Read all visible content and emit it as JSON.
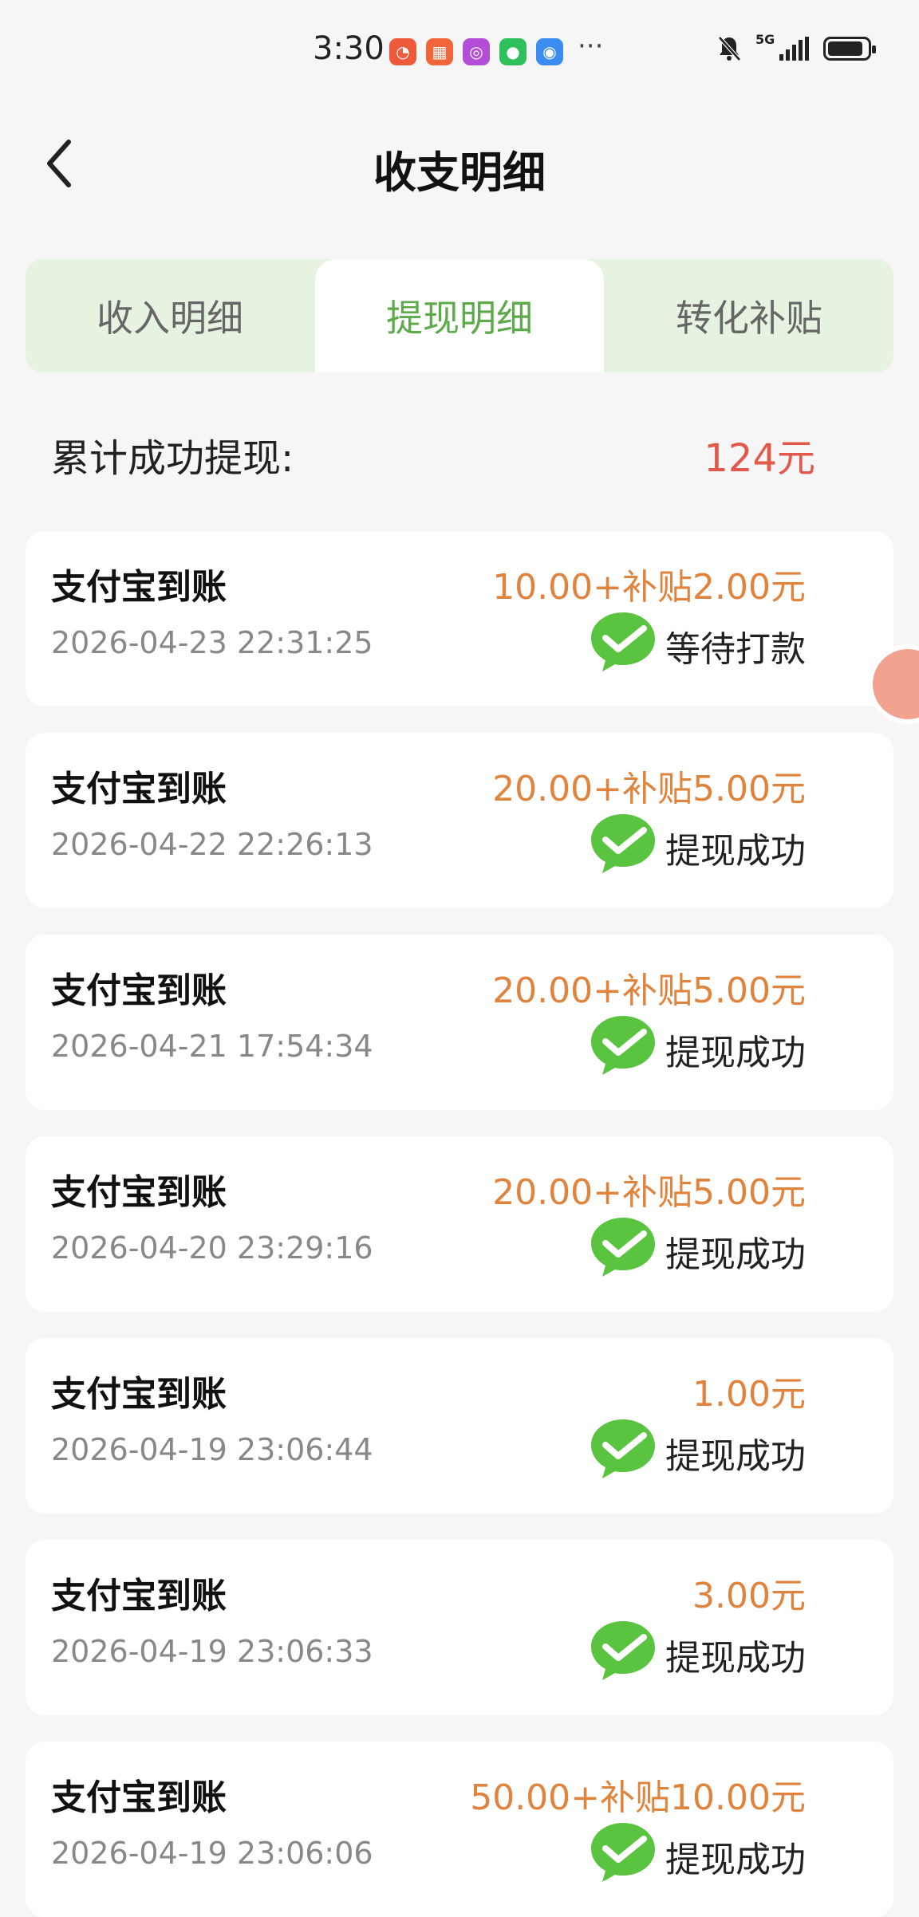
{
  "status_bar": {
    "time": "3:30",
    "app_icons": [
      {
        "name": "app-icon-1",
        "color": "#ef5a3c"
      },
      {
        "name": "app-icon-2",
        "color": "#f0663a"
      },
      {
        "name": "app-icon-3",
        "color": "#b34cd6"
      },
      {
        "name": "wechat-icon",
        "color": "#2ec05c"
      },
      {
        "name": "message-icon",
        "color": "#3b8cf0"
      }
    ],
    "more": "···",
    "network": "5G",
    "battery_level": 0.9
  },
  "header": {
    "title": "收支明细"
  },
  "tabs": [
    {
      "label": "收入明细",
      "active": false
    },
    {
      "label": "提现明细",
      "active": true
    },
    {
      "label": "转化补贴",
      "active": false
    }
  ],
  "summary": {
    "label": "累计成功提现:",
    "value": "124元"
  },
  "records": [
    {
      "title": "支付宝到账",
      "time": "2026-04-23 22:31:25",
      "amount": "10.00+补贴2.00元",
      "status": "等待打款"
    },
    {
      "title": "支付宝到账",
      "time": "2026-04-22 22:26:13",
      "amount": "20.00+补贴5.00元",
      "status": "提现成功"
    },
    {
      "title": "支付宝到账",
      "time": "2026-04-21 17:54:34",
      "amount": "20.00+补贴5.00元",
      "status": "提现成功"
    },
    {
      "title": "支付宝到账",
      "time": "2026-04-20 23:29:16",
      "amount": "20.00+补贴5.00元",
      "status": "提现成功"
    },
    {
      "title": "支付宝到账",
      "time": "2026-04-19 23:06:44",
      "amount": "1.00元",
      "status": "提现成功"
    },
    {
      "title": "支付宝到账",
      "time": "2026-04-19 23:06:33",
      "amount": "3.00元",
      "status": "提现成功"
    },
    {
      "title": "支付宝到账",
      "time": "2026-04-19 23:06:06",
      "amount": "50.00+补贴10.00元",
      "status": "提现成功"
    }
  ],
  "colors": {
    "accent_green": "#5daa4b",
    "tab_bg": "#e7f3e1",
    "amount_orange": "#e0833d",
    "total_red": "#e2584b",
    "wechat_green": "#5ac33f"
  }
}
